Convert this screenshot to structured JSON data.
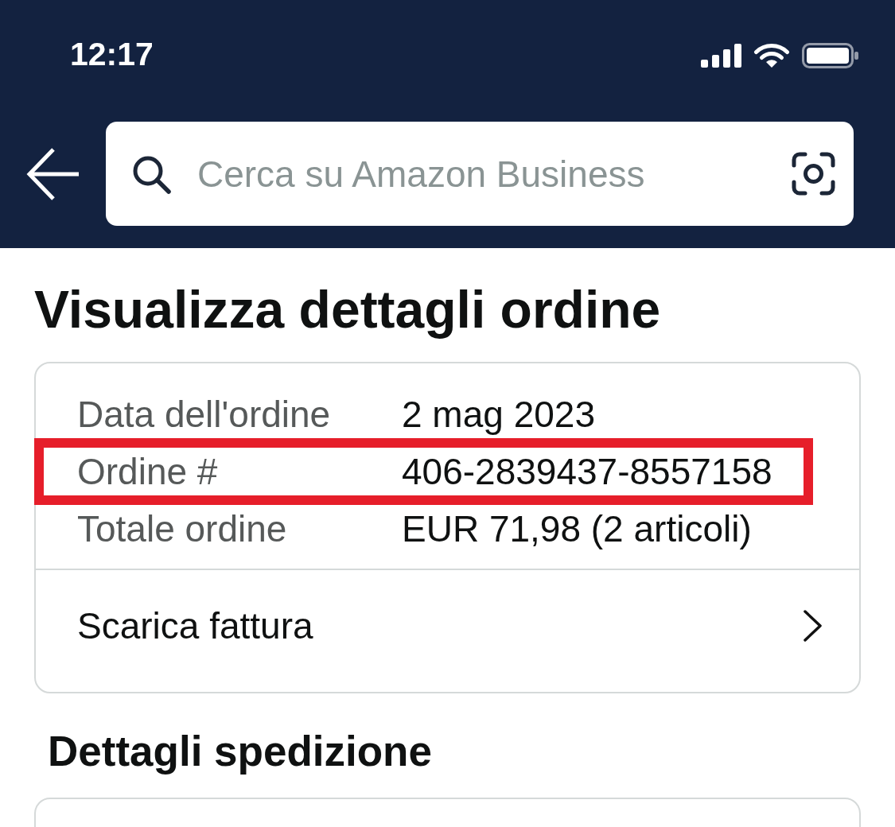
{
  "status_bar": {
    "time": "12:17"
  },
  "search_bar": {
    "placeholder": "Cerca su Amazon Business"
  },
  "page_title": "Visualizza dettagli ordine",
  "order_summary": {
    "rows": [
      {
        "label": "Data dell'ordine",
        "value": "2 mag 2023",
        "highlighted": false
      },
      {
        "label": "Ordine #",
        "value": "406-2839437-8557158",
        "highlighted": true
      },
      {
        "label": "Totale ordine",
        "value": "EUR 71,98 (2 articoli)",
        "highlighted": false
      }
    ],
    "invoice_link": "Scarica fattura"
  },
  "shipping_section": {
    "title": "Dettagli spedizione"
  }
}
